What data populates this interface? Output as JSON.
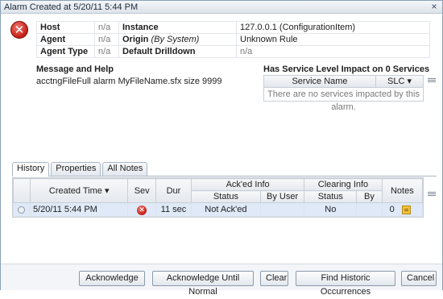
{
  "window": {
    "title": "Alarm Created at 5/20/11 5:44 PM",
    "close_glyph": "×"
  },
  "alarm": {
    "icon": "error-x-icon",
    "icon_glyph": "✕",
    "props": [
      {
        "k1": "Host",
        "v1": "n/a",
        "k2": "Instance",
        "v2": "127.0.0.1 (ConfigurationItem)"
      },
      {
        "k1": "Agent",
        "v1": "n/a",
        "k2": "Origin",
        "k2_sub": "(By System)",
        "v2": "Unknown Rule"
      },
      {
        "k1": "Agent Type",
        "v1": "n/a",
        "k2": "Default Drilldown",
        "v2": "n/a"
      }
    ]
  },
  "message": {
    "heading": "Message and Help",
    "text": "acctngFileFull alarm MyFileName.sfx size 9999"
  },
  "services": {
    "heading": "Has Service Level Impact on 0 Services",
    "columns": [
      "Service Name",
      "SLC ▾"
    ],
    "empty_text": "There are no services impacted by this alarm."
  },
  "tabs": [
    {
      "label": "History",
      "active": true
    },
    {
      "label": "Properties",
      "active": false
    },
    {
      "label": "All Notes",
      "active": false
    }
  ],
  "history": {
    "group_headers": {
      "created_time": "Created Time ▾",
      "sev": "Sev",
      "dur": "Dur",
      "acked_info": "Ack'ed Info",
      "clearing_info": "Clearing Info",
      "notes": "Notes"
    },
    "sub_headers": {
      "acked_status": "Status",
      "acked_by": "By User",
      "clearing_status": "Status",
      "clearing_by": "By"
    },
    "rows": [
      {
        "created_time": "5/20/11 5:44 PM",
        "sev_icon": "error-x-icon",
        "sev_glyph": "✕",
        "dur": "11 sec",
        "acked_status": "Not Ack'ed",
        "acked_by": "",
        "clearing_status": "No",
        "clearing_by": "",
        "notes_count": "0",
        "notes_icon": "note-icon"
      }
    ]
  },
  "footer_buttons": {
    "acknowledge": "Acknowledge",
    "ack_until_normal": "Acknowledge Until Normal",
    "clear": "Clear",
    "find_historic": "Find Historic Occurrences",
    "cancel": "Cancel"
  }
}
